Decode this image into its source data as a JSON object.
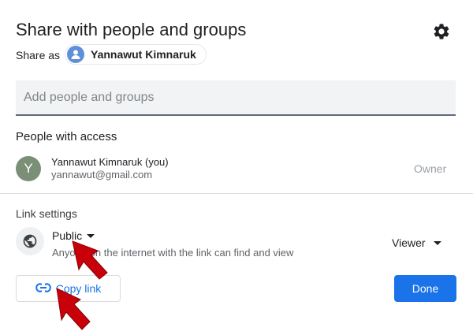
{
  "dialog": {
    "title": "Share with people and groups",
    "settings_icon": "gear-icon",
    "share_as": {
      "label": "Share as",
      "account_name": "Yannawut Kimnaruk"
    },
    "add_people": {
      "placeholder": "Add people and groups",
      "value": ""
    }
  },
  "people_with_access": {
    "heading": "People with access",
    "people": [
      {
        "avatar_letter": "Y",
        "name": "Yannawut Kimnaruk (you)",
        "email": "yannawut@gmail.com",
        "role": "Owner"
      }
    ]
  },
  "link_settings": {
    "heading": "Link settings",
    "access_icon": "globe-icon",
    "access_level": "Public",
    "description": "Anyone on the internet with the link can find and view",
    "role": "Viewer"
  },
  "footer": {
    "copy_link_label": "Copy link",
    "copy_link_icon": "link-icon",
    "done_label": "Done"
  },
  "colors": {
    "accent": "#1a73e8",
    "annotation_arrow": "#c8000a"
  }
}
